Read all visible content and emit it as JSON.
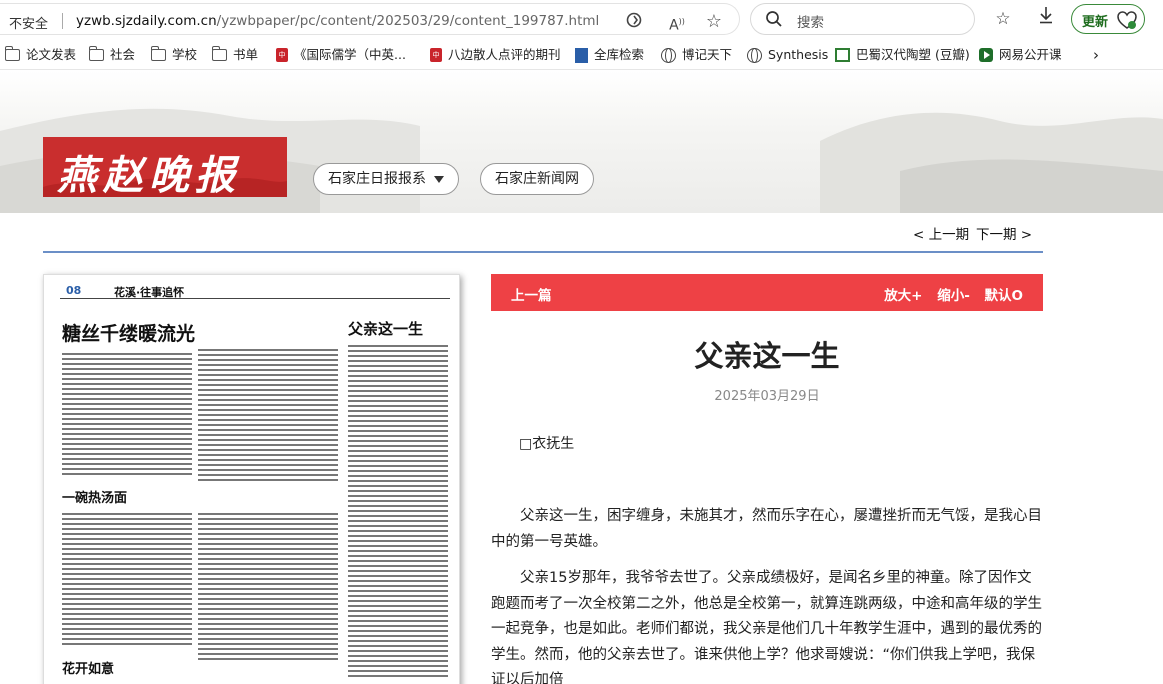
{
  "browser": {
    "security": "不安全",
    "url_host": "yzwb.sjzdaily.com.cn",
    "url_path": "/yzwbpaper/pc/content/202503/29/content_199787.html",
    "search_placeholder": "搜索",
    "update_label": "更新",
    "bookmarks": [
      {
        "label": "论文发表",
        "icon": "folder-icon"
      },
      {
        "label": "社会",
        "icon": "folder-icon"
      },
      {
        "label": "学校",
        "icon": "folder-icon"
      },
      {
        "label": "书单",
        "icon": "folder-icon"
      },
      {
        "label": "《国际儒学（中英...",
        "icon": "site-icon"
      },
      {
        "label": "八边散人点评的期刊",
        "icon": "site-icon"
      },
      {
        "label": "全库检索",
        "icon": "site-icon"
      },
      {
        "label": "博记天下",
        "icon": "globe-icon"
      },
      {
        "label": "Synthesis",
        "icon": "globe-icon"
      },
      {
        "label": "巴蜀汉代陶塑 (豆瓣)",
        "icon": "site-icon"
      },
      {
        "label": "网易公开课",
        "icon": "site-icon"
      }
    ]
  },
  "site": {
    "logo_text": "燕赵晚报",
    "nav": [
      "石家庄日报报系",
      "石家庄新闻网"
    ],
    "prev_issue": "< 上一期",
    "next_issue": "下一期 >"
  },
  "paper": {
    "page_no": "08",
    "section": "花溪·往事追怀",
    "headlines": [
      "糖丝千缕暖流光",
      "父亲这一生",
      "一碗热汤面",
      "花开如意"
    ]
  },
  "article": {
    "prev_label": "上一篇",
    "zoom_in": "放大+",
    "zoom_out": "缩小-",
    "reset": "默认O",
    "title": "父亲这一生",
    "date": "2025年03月29日",
    "author": "□衣抚生",
    "paragraphs": [
      "父亲这一生，困字缠身，未施其才，然而乐字在心，屡遭挫折而无气馁，是我心目中的第一号英雄。",
      "父亲15岁那年，我爷爷去世了。父亲成绩极好，是闻名乡里的神童。除了因作文跑题而考了一次全校第二之外，他总是全校第一，就算连跳两级，中途和高年级的学生一起竞争，也是如此。老师们都说，我父亲是他们几十年教学生涯中，遇到的最优秀的学生。然而，他的父亲去世了。谁来供他上学？他求哥嫂说：“你们供我上学吧，我保证以后加倍"
    ]
  }
}
